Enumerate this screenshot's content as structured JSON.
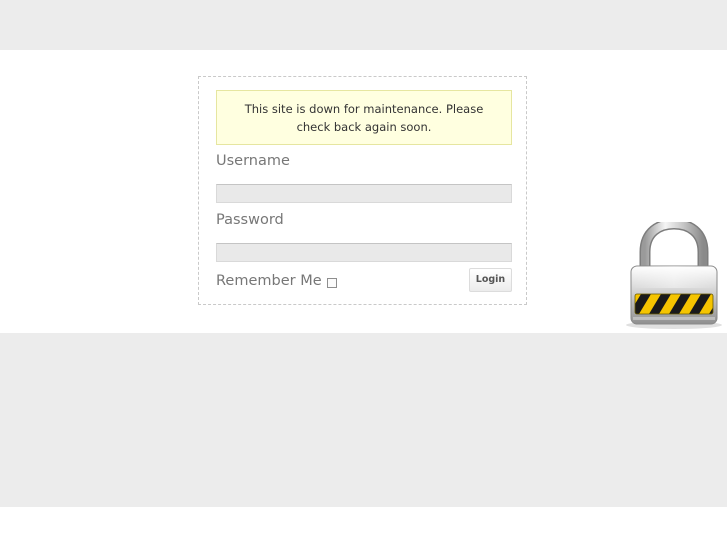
{
  "notice": {
    "message": "This site is down for maintenance. Please check back again soon."
  },
  "form": {
    "username_label": "Username",
    "username_value": "",
    "password_label": "Password",
    "password_value": "",
    "remember_label": "Remember Me",
    "remember_checked": false,
    "login_label": "Login"
  },
  "icons": {
    "padlock": "padlock-icon"
  },
  "colors": {
    "notice_background": "#ffffe0",
    "band_gray": "#ececec"
  }
}
